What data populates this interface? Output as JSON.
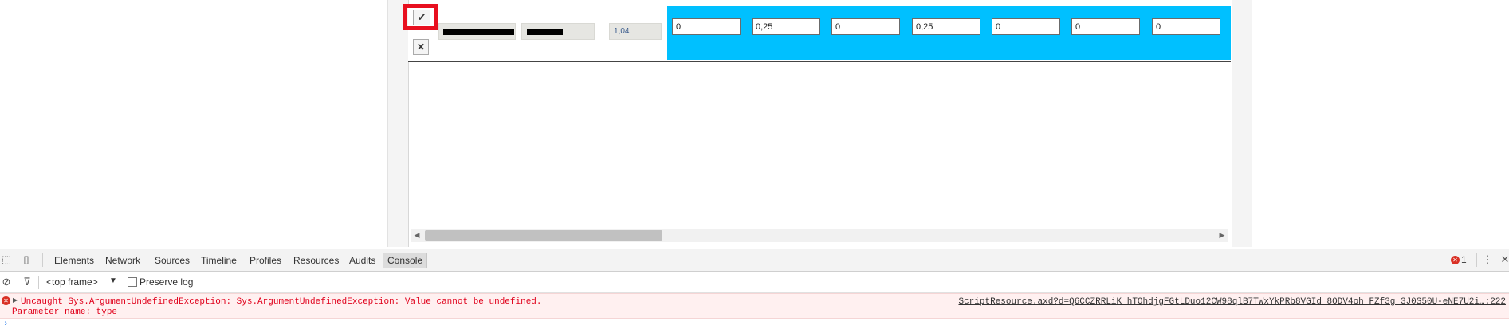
{
  "grid": {
    "edit_icon": "check-icon",
    "edit_glyph": "✔",
    "cancel_icon": "close-icon",
    "cancel_glyph": "✕",
    "value_cell": "1,04",
    "inputs": [
      "0",
      "0,25",
      "0",
      "0,25",
      "0",
      "0",
      "0"
    ],
    "band_color": "#00c0ff"
  },
  "scrollbar": {
    "left_arrow": "◀",
    "right_arrow": "▶"
  },
  "devtools": {
    "inspect_glyph": "⬚",
    "device_glyph": "▯",
    "tabs": [
      "Elements",
      "Network",
      "Sources",
      "Timeline",
      "Profiles",
      "Resources",
      "Audits",
      "Console"
    ],
    "active_tab": "Console",
    "error_count": "1",
    "error_glyph": "✕",
    "more_glyph": "⋮",
    "close_glyph": "✕",
    "clear_glyph": "⊘",
    "filter_glyph": "⊽",
    "frame_select": "<top frame>",
    "frame_arrow": "▼",
    "preserve_log": "Preserve log"
  },
  "console": {
    "error_line1": "Uncaught Sys.ArgumentUndefinedException: Sys.ArgumentUndefinedException: Value cannot be undefined.",
    "error_line2": "Parameter name: type",
    "source_link": "ScriptResource.axd?d=Q6CCZRRLiK_hTOhdjgFGtLDuo12CW98qlB7TWxYkPRb8VGId_8ODV4oh_FZf3g_3J0S50U-eNE7U2i…:222",
    "expand_glyph": "▶",
    "prompt_glyph": "›"
  }
}
